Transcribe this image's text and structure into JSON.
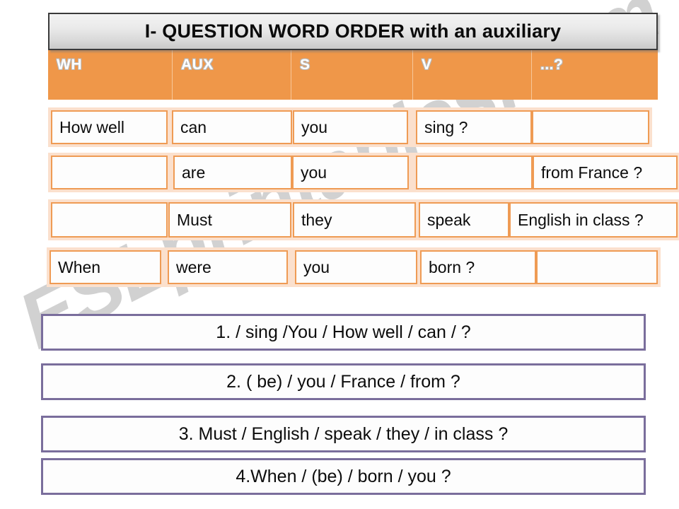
{
  "watermark": {
    "text": "ESLprintables.com"
  },
  "title": {
    "text": "I- QUESTION WORD ORDER  with an auxiliary"
  },
  "colors": {
    "orange": "#ef9749",
    "cell_border": "#ef9b54",
    "row_band": "#fbe0cd",
    "exercise_border": "#7a6e9c",
    "title_border": "#3a3a3a",
    "text": "#0c0c0c"
  },
  "table": {
    "headers": [
      {
        "label": "WH"
      },
      {
        "label": "AUX"
      },
      {
        "label": "S"
      },
      {
        "label": "V"
      },
      {
        "label": "...?"
      }
    ],
    "rows": [
      {
        "cells": [
          "How well",
          "can",
          "you",
          "sing ?",
          ""
        ]
      },
      {
        "cells": [
          "",
          "are",
          "you",
          "",
          "from France ?"
        ]
      },
      {
        "cells": [
          "",
          "Must",
          "they",
          "speak",
          "English in class ?"
        ]
      },
      {
        "cells": [
          "When",
          "were",
          "you",
          "born ?",
          ""
        ]
      }
    ]
  },
  "exercises": [
    {
      "text": "1.  / sing /You /  How well / can / ?"
    },
    {
      "text": "2. ( be) /  you / France / from  ?"
    },
    {
      "text": "3. Must / English / speak / they / in class ?"
    },
    {
      "text": "4.When / (be) / born / you ?"
    }
  ]
}
